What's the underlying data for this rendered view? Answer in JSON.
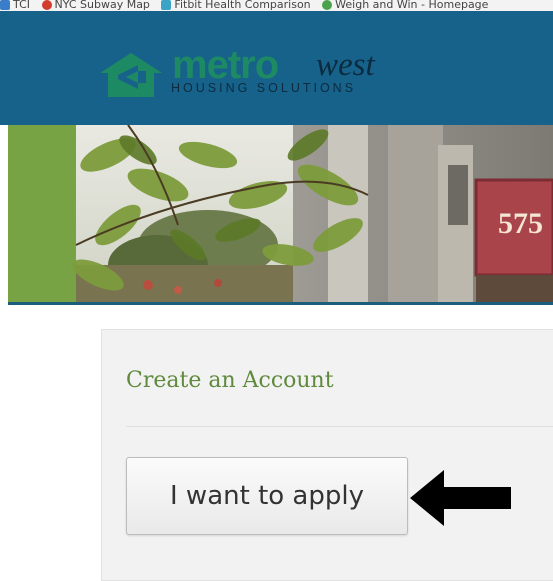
{
  "bookmarks_bar": {
    "items": [
      {
        "label": "TCI",
        "icon": "bookmark-icon",
        "color": "#3a7dc9"
      },
      {
        "label": "NYC Subway Map",
        "icon": "red-circle-icon",
        "color": "#d33b2c"
      },
      {
        "label": "Fitbit Health Comparison",
        "icon": "star-icon",
        "color": "#3aa3c7"
      },
      {
        "label": "Weigh and Win - Homepage",
        "icon": "green-circle-icon",
        "color": "#4aa34a"
      }
    ]
  },
  "header": {
    "background_color": "#16628a",
    "logo": {
      "brand_primary": "metro",
      "brand_secondary": "west",
      "tagline": "HOUSING SOLUTIONS",
      "brand_color": "#1e8a63"
    }
  },
  "banner": {
    "sign_text": "575"
  },
  "main": {
    "card": {
      "title": "Create an Account",
      "title_color": "#5f8a3d",
      "apply_button_label": "I want to apply"
    }
  },
  "annotation": {
    "arrow_direction": "left",
    "arrow_icon": "left-arrow-icon"
  }
}
